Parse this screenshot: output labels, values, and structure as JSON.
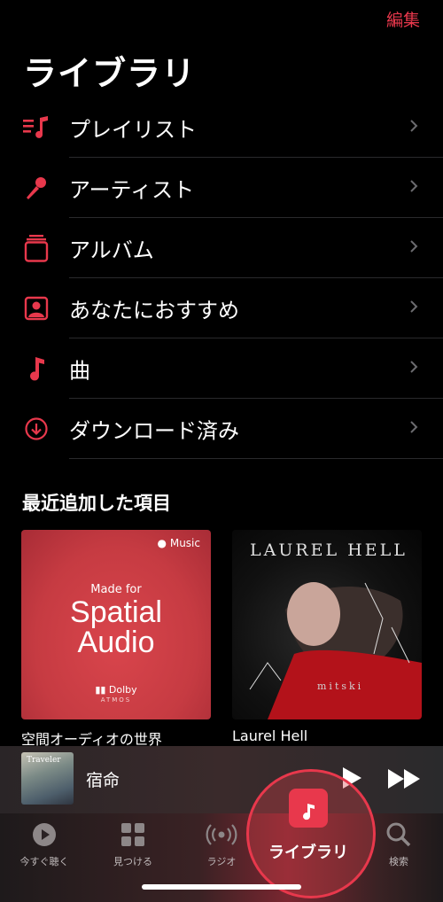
{
  "header": {
    "edit_label": "編集",
    "title": "ライブラリ"
  },
  "menu": {
    "items": [
      {
        "label": "プレイリスト",
        "icon": "playlist-icon"
      },
      {
        "label": "アーティスト",
        "icon": "microphone-icon"
      },
      {
        "label": "アルバム",
        "icon": "album-icon"
      },
      {
        "label": "あなたにおすすめ",
        "icon": "person-square-icon"
      },
      {
        "label": "曲",
        "icon": "music-note-icon"
      },
      {
        "label": "ダウンロード済み",
        "icon": "download-circle-icon"
      }
    ]
  },
  "recent": {
    "title": "最近追加した項目",
    "albums": [
      {
        "caption": "空間オーディオの世界",
        "art": {
          "badge": "Music",
          "made_for": "Made for",
          "line1": "Spatial",
          "line2": "Audio",
          "dolby": "Dolby",
          "atmos": "ATMOS"
        }
      },
      {
        "caption": "Laurel Hell",
        "art": {
          "title": "LAUREL HELL",
          "artist": "mitski"
        }
      }
    ]
  },
  "player": {
    "song": "宿命",
    "art_text": "Traveler"
  },
  "tabs": {
    "now": "今すぐ聴く",
    "browse": "見つける",
    "radio": "ラジオ",
    "library": "ライブラリ",
    "search": "検索"
  },
  "colors": {
    "accent": "#e8384c",
    "background": "#000000"
  }
}
